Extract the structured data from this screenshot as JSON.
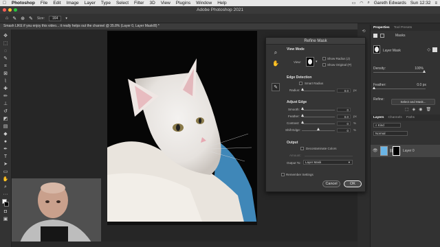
{
  "menubar": {
    "apple": "",
    "items": [
      "Photoshop",
      "File",
      "Edit",
      "Image",
      "Layer",
      "Type",
      "Select",
      "Filter",
      "3D",
      "View",
      "Plugins",
      "Window",
      "Help"
    ],
    "user": "Gareth Edwards",
    "clock": "Sun 12:32"
  },
  "window_title": "Adobe Photoshop 2021",
  "options_bar": {
    "size_label": "Size:",
    "size_value": "164"
  },
  "document_tab": "Smash LIKE if you enjoy this video... it really helps out the channel @ 35.8% (Layer 0, Layer Mask/8) *",
  "refine_mask": {
    "title": "Refine Mask",
    "view_mode": {
      "heading": "View Mode",
      "view_label": "View:",
      "show_radius": "Show Radius (J)",
      "show_original": "Show Original (P)"
    },
    "edge_detection": {
      "heading": "Edge Detection",
      "smart_radius": "Smart Radius",
      "radius_label": "Radius:",
      "radius_value": "0.0",
      "radius_unit": "px"
    },
    "adjust_edge": {
      "heading": "Adjust Edge",
      "smooth_label": "Smooth:",
      "smooth_value": "0",
      "feather_label": "Feather:",
      "feather_value": "0.0",
      "feather_unit": "px",
      "contrast_label": "Contrast:",
      "contrast_value": "0",
      "contrast_unit": "%",
      "shift_label": "Shift Edge:",
      "shift_value": "0",
      "shift_unit": "%"
    },
    "output": {
      "heading": "Output",
      "decontaminate": "Decontaminate Colors",
      "amount_label": "Amount:",
      "output_to_label": "Output To:",
      "output_to_value": "Layer Mask"
    },
    "remember": "Remember Settings",
    "cancel": "Cancel",
    "ok": "OK"
  },
  "properties_panel": {
    "tab_active": "Properties",
    "tab_inactive": "Tool Presets",
    "masks_label": "Masks",
    "layer_mask_label": "Layer Mask",
    "density_label": "Density:",
    "density_value": "100%",
    "feather_label": "Feather:",
    "feather_value": "0.0 px",
    "refine_label": "Refine:",
    "select_mask_button": "Select and Mask..."
  },
  "layers_panel": {
    "tabs": [
      "Layers",
      "Channels",
      "Paths"
    ],
    "kind_label": "Kind",
    "blend_mode": "Normal",
    "layer_name": "Layer 0"
  },
  "colors": {
    "accent_blue": "#3d7ee6",
    "mask_overlay": "#59b6ee"
  }
}
